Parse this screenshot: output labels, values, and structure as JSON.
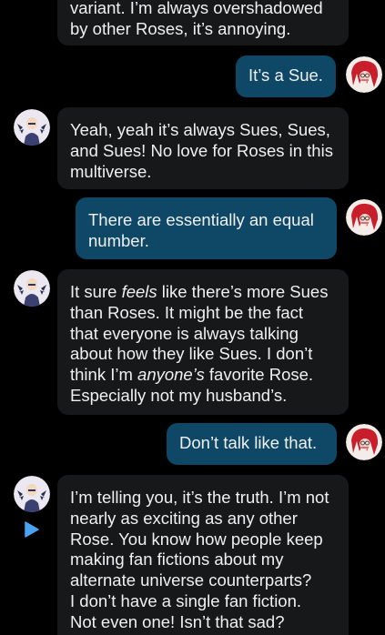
{
  "messages": [
    {
      "sender": "other",
      "text": "variant.  I’m always overshadowed by other Roses, it’s annoying."
    },
    {
      "sender": "self",
      "text": "It’s a Sue."
    },
    {
      "sender": "other",
      "text": "Yeah, yeah it’s always Sues, Sues, and Sues!  No love for Roses in this multiverse."
    },
    {
      "sender": "self",
      "text": "There are essentially an equal number."
    },
    {
      "sender": "other",
      "segments": [
        {
          "text": "It sure "
        },
        {
          "text": "feels",
          "italic": true
        },
        {
          "text": " like there’s more Sues than Roses.  It might be the fact that everyone is always talking about how they like Sues.  I don’t think I’m "
        },
        {
          "text": "anyone’s",
          "italic": true
        },
        {
          "text": " favorite Rose.  Especially not my husband’s."
        }
      ]
    },
    {
      "sender": "self",
      "text": "Don’t talk like that."
    },
    {
      "sender": "other",
      "text": "I’m telling you, it’s the truth.  I’m not nearly as exciting as any other Rose.  You know how people keep making fan fictions about my alternate universe counterparts?\nI don’t have a single fan fiction.\nNot even one!  Isn’t that sad?"
    }
  ],
  "colors": {
    "background": "#000000",
    "incoming_bubble": "#17181a",
    "outgoing_bubble": "#0f4766",
    "text": "#eef0f2",
    "play_icon": "#4aa3f0"
  },
  "icons": {
    "other_avatar": "character-avatar-icon",
    "self_avatar": "red-haired-character-avatar-icon",
    "play": "play-icon"
  }
}
